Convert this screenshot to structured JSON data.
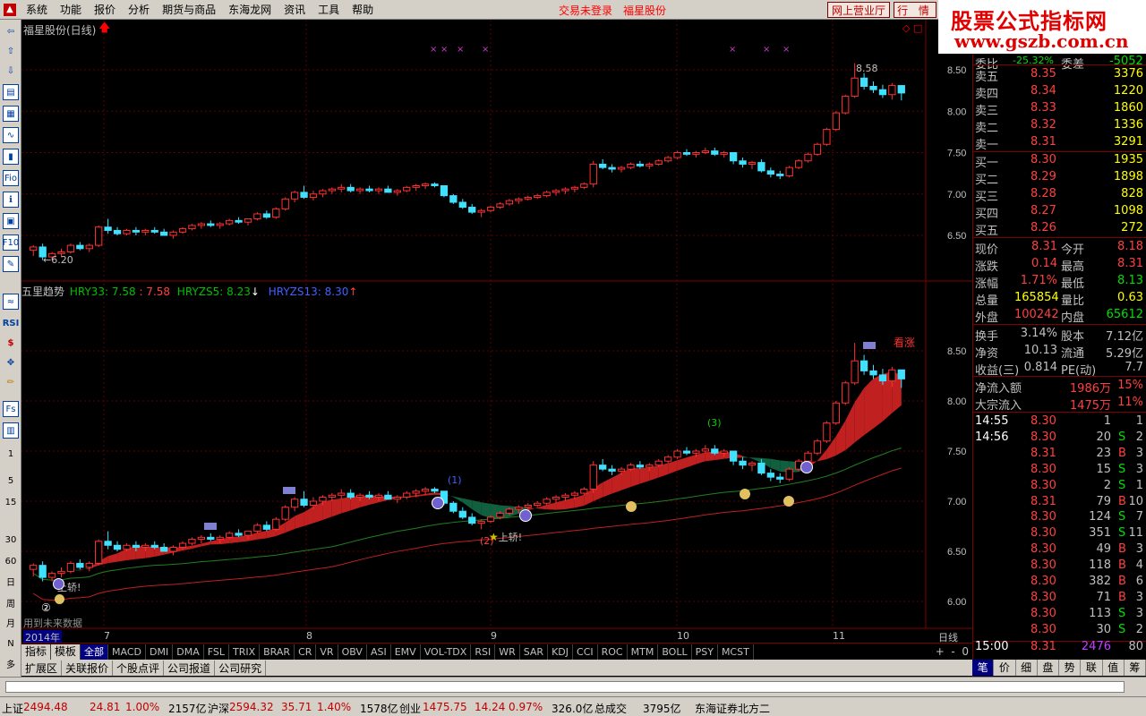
{
  "menu": {
    "items": [
      "系统",
      "功能",
      "报价",
      "分析",
      "期货与商品",
      "东海龙网",
      "资讯",
      "工具",
      "帮助"
    ],
    "status": "交易未登录",
    "stock_name": "福星股份",
    "online_button": "网上营业厅",
    "quote_button": "行 情"
  },
  "banner": {
    "line1": "股票公式指标网",
    "line2": "www.gszb.com.cn"
  },
  "left_toolbar": [
    "Fio",
    "F10",
    "RSI",
    "Fs",
    "1",
    "5",
    "15",
    "30",
    "60",
    "日",
    "周",
    "月",
    "N",
    "多"
  ],
  "main_chart": {
    "title": "福星股份(日线)",
    "price_high_label": "8.58",
    "price_low_label": "6.20",
    "axis_labels": [
      "8.50",
      "8.00",
      "7.50",
      "7.00",
      "6.50"
    ]
  },
  "indicator": {
    "name": "五里趋势",
    "hry33_label": "HRY33: 7.58",
    "hry33_extra": ": 7.58",
    "hryzs5_label": "HRYZS5: 8.23",
    "hryzs13_label": "HRYZS13: 8.30",
    "kanzhang": "看涨",
    "axis_labels": [
      "8.50",
      "8.00",
      "7.50",
      "7.00",
      "6.50",
      "6.00"
    ],
    "marker_1": "(1)",
    "marker_2": "(2)",
    "marker_3": "(3)",
    "marker_circle": "②",
    "shangjiao": "上轿!",
    "future_note": "用到未来数据"
  },
  "time_axis": {
    "year": "2014年",
    "months": [
      "7",
      "8",
      "9",
      "10",
      "11"
    ],
    "period": "日线"
  },
  "chart_data": {
    "type": "candlestick",
    "title": "福星股份(日线)",
    "ylim": [
      6.1,
      8.7
    ],
    "candles": [
      [
        6.32,
        6.38,
        6.25,
        6.36
      ],
      [
        6.36,
        6.4,
        6.2,
        6.24
      ],
      [
        6.24,
        6.3,
        6.2,
        6.28
      ],
      [
        6.28,
        6.34,
        6.24,
        6.3
      ],
      [
        6.3,
        6.4,
        6.28,
        6.38
      ],
      [
        6.38,
        6.42,
        6.32,
        6.34
      ],
      [
        6.34,
        6.4,
        6.3,
        6.38
      ],
      [
        6.38,
        6.62,
        6.36,
        6.6
      ],
      [
        6.6,
        6.7,
        6.52,
        6.56
      ],
      [
        6.56,
        6.6,
        6.5,
        6.52
      ],
      [
        6.52,
        6.58,
        6.5,
        6.56
      ],
      [
        6.56,
        6.6,
        6.5,
        6.54
      ],
      [
        6.54,
        6.58,
        6.5,
        6.56
      ],
      [
        6.56,
        6.6,
        6.52,
        6.54
      ],
      [
        6.54,
        6.58,
        6.5,
        6.5
      ],
      [
        6.5,
        6.56,
        6.46,
        6.54
      ],
      [
        6.54,
        6.6,
        6.52,
        6.58
      ],
      [
        6.58,
        6.64,
        6.56,
        6.62
      ],
      [
        6.62,
        6.66,
        6.58,
        6.64
      ],
      [
        6.64,
        6.68,
        6.6,
        6.62
      ],
      [
        6.62,
        6.66,
        6.58,
        6.64
      ],
      [
        6.64,
        6.7,
        6.62,
        6.68
      ],
      [
        6.68,
        6.72,
        6.64,
        6.66
      ],
      [
        6.66,
        6.7,
        6.62,
        6.7
      ],
      [
        6.7,
        6.78,
        6.68,
        6.76
      ],
      [
        6.76,
        6.8,
        6.7,
        6.72
      ],
      [
        6.72,
        6.84,
        6.7,
        6.82
      ],
      [
        6.82,
        6.96,
        6.8,
        6.94
      ],
      [
        6.94,
        7.04,
        6.9,
        7.02
      ],
      [
        7.02,
        7.1,
        6.94,
        6.96
      ],
      [
        6.96,
        7.04,
        6.92,
        7.0
      ],
      [
        7.0,
        7.06,
        6.96,
        7.04
      ],
      [
        7.04,
        7.08,
        7.0,
        7.06
      ],
      [
        7.06,
        7.12,
        7.02,
        7.08
      ],
      [
        7.08,
        7.12,
        7.02,
        7.04
      ],
      [
        7.04,
        7.08,
        7.0,
        7.06
      ],
      [
        7.06,
        7.1,
        7.02,
        7.04
      ],
      [
        7.04,
        7.08,
        7.0,
        7.06
      ],
      [
        7.06,
        7.1,
        7.02,
        7.02
      ],
      [
        7.02,
        7.06,
        6.98,
        7.04
      ],
      [
        7.04,
        7.1,
        7.02,
        7.08
      ],
      [
        7.08,
        7.12,
        7.04,
        7.1
      ],
      [
        7.1,
        7.14,
        7.06,
        7.12
      ],
      [
        7.12,
        7.14,
        7.08,
        7.1
      ],
      [
        7.1,
        7.06,
        6.96,
        6.98
      ],
      [
        6.98,
        7.0,
        6.88,
        6.9
      ],
      [
        6.9,
        6.94,
        6.82,
        6.84
      ],
      [
        6.84,
        6.88,
        6.76,
        6.78
      ],
      [
        6.78,
        6.82,
        6.72,
        6.8
      ],
      [
        6.8,
        6.86,
        6.78,
        6.84
      ],
      [
        6.84,
        6.9,
        6.82,
        6.88
      ],
      [
        6.88,
        6.94,
        6.86,
        6.92
      ],
      [
        6.92,
        6.96,
        6.88,
        6.94
      ],
      [
        6.94,
        6.98,
        6.92,
        6.96
      ],
      [
        6.96,
        7.0,
        6.94,
        6.98
      ],
      [
        6.98,
        7.04,
        6.96,
        7.02
      ],
      [
        7.02,
        7.06,
        6.98,
        7.04
      ],
      [
        7.04,
        7.08,
        7.0,
        7.06
      ],
      [
        7.06,
        7.1,
        7.02,
        7.08
      ],
      [
        7.08,
        7.14,
        7.06,
        7.12
      ],
      [
        7.12,
        7.4,
        7.08,
        7.36
      ],
      [
        7.36,
        7.42,
        7.3,
        7.32
      ],
      [
        7.32,
        7.36,
        7.26,
        7.3
      ],
      [
        7.3,
        7.34,
        7.26,
        7.32
      ],
      [
        7.32,
        7.38,
        7.3,
        7.36
      ],
      [
        7.36,
        7.4,
        7.32,
        7.34
      ],
      [
        7.34,
        7.38,
        7.3,
        7.36
      ],
      [
        7.36,
        7.42,
        7.34,
        7.4
      ],
      [
        7.4,
        7.46,
        7.38,
        7.44
      ],
      [
        7.44,
        7.52,
        7.42,
        7.5
      ],
      [
        7.5,
        7.54,
        7.46,
        7.48
      ],
      [
        7.48,
        7.52,
        7.44,
        7.5
      ],
      [
        7.5,
        7.56,
        7.48,
        7.52
      ],
      [
        7.52,
        7.56,
        7.46,
        7.48
      ],
      [
        7.48,
        7.52,
        7.44,
        7.5
      ],
      [
        7.5,
        7.46,
        7.36,
        7.4
      ],
      [
        7.4,
        7.44,
        7.32,
        7.36
      ],
      [
        7.36,
        7.4,
        7.3,
        7.38
      ],
      [
        7.38,
        7.42,
        7.26,
        7.28
      ],
      [
        7.28,
        7.32,
        7.2,
        7.24
      ],
      [
        7.24,
        7.28,
        7.18,
        7.22
      ],
      [
        7.22,
        7.34,
        7.2,
        7.32
      ],
      [
        7.32,
        7.42,
        7.3,
        7.4
      ],
      [
        7.4,
        7.5,
        7.38,
        7.48
      ],
      [
        7.48,
        7.62,
        7.46,
        7.6
      ],
      [
        7.6,
        7.8,
        7.58,
        7.78
      ],
      [
        7.78,
        8.0,
        7.76,
        7.98
      ],
      [
        7.98,
        8.2,
        7.96,
        8.18
      ],
      [
        8.18,
        8.58,
        8.16,
        8.4
      ],
      [
        8.4,
        8.46,
        8.26,
        8.3
      ],
      [
        8.3,
        8.36,
        8.22,
        8.26
      ],
      [
        8.26,
        8.32,
        8.16,
        8.2
      ],
      [
        8.2,
        8.34,
        8.14,
        8.31
      ],
      [
        8.31,
        8.31,
        8.13,
        8.22
      ]
    ]
  },
  "quote": {
    "weibi_label": "委比",
    "weibi_value": "-25.32%",
    "weicha_label": "委差",
    "weicha_value": "-5052",
    "asks": [
      {
        "label": "卖五",
        "price": "8.35",
        "vol": "3376"
      },
      {
        "label": "卖四",
        "price": "8.34",
        "vol": "1220"
      },
      {
        "label": "卖三",
        "price": "8.33",
        "vol": "1860"
      },
      {
        "label": "卖二",
        "price": "8.32",
        "vol": "1336"
      },
      {
        "label": "卖一",
        "price": "8.31",
        "vol": "3291"
      }
    ],
    "bids": [
      {
        "label": "买一",
        "price": "8.30",
        "vol": "1935"
      },
      {
        "label": "买二",
        "price": "8.29",
        "vol": "1898"
      },
      {
        "label": "买三",
        "price": "8.28",
        "vol": "828"
      },
      {
        "label": "买四",
        "price": "8.27",
        "vol": "1098"
      },
      {
        "label": "买五",
        "price": "8.26",
        "vol": "272"
      }
    ],
    "stats": [
      {
        "l1": "现价",
        "v1": "8.31",
        "l2": "今开",
        "v2": "8.18"
      },
      {
        "l1": "涨跌",
        "v1": "0.14",
        "l2": "最高",
        "v2": "8.31"
      },
      {
        "l1": "涨幅",
        "v1": "1.71%",
        "l2": "最低",
        "v2": "8.13"
      },
      {
        "l1": "总量",
        "v1": "165854",
        "l2": "量比",
        "v2": "0.63"
      },
      {
        "l1": "外盘",
        "v1": "100242",
        "l2": "内盘",
        "v2": "65612"
      }
    ],
    "stats2": [
      {
        "l1": "换手",
        "v1": "3.14%",
        "l2": "股本",
        "v2": "7.12亿"
      },
      {
        "l1": "净资",
        "v1": "10.13",
        "l2": "流通",
        "v2": "5.29亿"
      },
      {
        "l1": "收益(三)",
        "v1": "0.814",
        "l2": "PE(动)",
        "v2": "7.7"
      }
    ],
    "flow": [
      {
        "label": "净流入额",
        "value": "1986万",
        "pct": "15%"
      },
      {
        "label": "大宗流入",
        "value": "1475万",
        "pct": "11%"
      }
    ],
    "ticks": [
      {
        "time": "14:55",
        "price": "8.30",
        "vol": "1",
        "bs": "",
        "n": "1"
      },
      {
        "time": "14:56",
        "price": "8.30",
        "vol": "20",
        "bs": "S",
        "n": "2"
      },
      {
        "time": "",
        "price": "8.31",
        "vol": "23",
        "bs": "B",
        "n": "3"
      },
      {
        "time": "",
        "price": "8.30",
        "vol": "15",
        "bs": "S",
        "n": "3"
      },
      {
        "time": "",
        "price": "8.30",
        "vol": "2",
        "bs": "S",
        "n": "1"
      },
      {
        "time": "",
        "price": "8.31",
        "vol": "79",
        "bs": "B",
        "n": "10"
      },
      {
        "time": "",
        "price": "8.30",
        "vol": "124",
        "bs": "S",
        "n": "7"
      },
      {
        "time": "",
        "price": "8.30",
        "vol": "351",
        "bs": "S",
        "n": "11"
      },
      {
        "time": "",
        "price": "8.30",
        "vol": "49",
        "bs": "B",
        "n": "3"
      },
      {
        "time": "",
        "price": "8.30",
        "vol": "118",
        "bs": "B",
        "n": "4"
      },
      {
        "time": "",
        "price": "8.30",
        "vol": "382",
        "bs": "B",
        "n": "6"
      },
      {
        "time": "",
        "price": "8.30",
        "vol": "71",
        "bs": "B",
        "n": "3"
      },
      {
        "time": "",
        "price": "8.30",
        "vol": "113",
        "bs": "S",
        "n": "3"
      },
      {
        "time": "",
        "price": "8.30",
        "vol": "30",
        "bs": "S",
        "n": "2"
      }
    ],
    "final": {
      "time": "15:00",
      "price": "8.31",
      "vol": "2476",
      "n": "80"
    }
  },
  "bottom_tabs": [
    "指标",
    "模板",
    "全部",
    "MACD",
    "DMI",
    "DMA",
    "FSL",
    "TRIX",
    "BRAR",
    "CR",
    "VR",
    "OBV",
    "ASI",
    "EMV",
    "VOL-TDX",
    "RSI",
    "WR",
    "SAR",
    "KDJ",
    "CCI",
    "ROC",
    "MTM",
    "BOLL",
    "PSY",
    "MCST"
  ],
  "bottom_tabs2": [
    "扩展区",
    "关联报价",
    "个股点评",
    "公司报道",
    "公司研究"
  ],
  "right_tabs": [
    "笔",
    "价",
    "细",
    "盘",
    "势",
    "联",
    "值",
    "筹"
  ],
  "statusbar": {
    "sh_label": "上证",
    "sh_value": "2494.48",
    "sh_change": "24.81",
    "sh_pct": "1.00%",
    "sh_amount": "2157亿",
    "hs_label": "沪深",
    "hs_value": "2594.32",
    "hs_change": "35.71",
    "hs_pct": "1.40%",
    "hs_amount": "1578亿",
    "cy_label": "创业",
    "cy_value": "1475.75",
    "cy_change": "14.24",
    "cy_pct": "0.97%",
    "cy_amount": "326.0亿",
    "total_label": "总成交",
    "total_value": "3795亿",
    "server": "东海证券北方二"
  }
}
